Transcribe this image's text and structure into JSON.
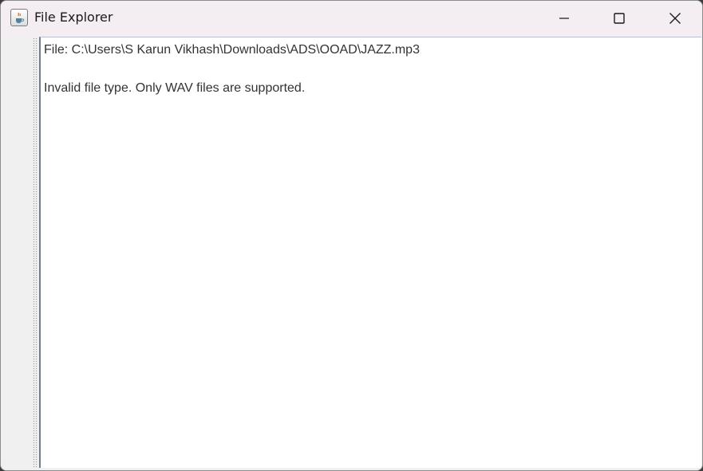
{
  "window": {
    "title": "File Explorer",
    "icon": "java-cup-icon",
    "controls": {
      "minimize": "minimize-icon",
      "maximize": "maximize-icon",
      "close": "close-icon"
    }
  },
  "output": {
    "file_line": "File: C:\\Users\\S Karun Vikhash\\Downloads\\ADS\\OOAD\\JAZZ.mp3",
    "blank_line": "",
    "message_line": "Invalid file type. Only WAV files are supported."
  }
}
